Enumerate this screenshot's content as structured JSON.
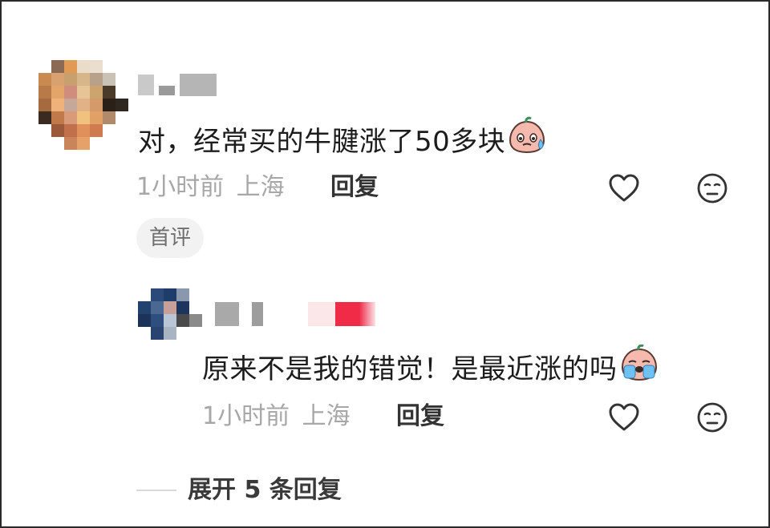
{
  "comments": [
    {
      "text": "对，经常买的牛腱涨了50多块",
      "emoji": "sweat-smile-emoji",
      "time": "1小时前",
      "location": "上海",
      "reply_label": "回复",
      "badge": "首评"
    },
    {
      "text": "原来不是我的错觉！是最近涨的吗",
      "emoji": "crying-emoji",
      "time": "1小时前",
      "location": "上海",
      "reply_label": "回复"
    }
  ],
  "expand_label": "展开 5 条回复",
  "icons": [
    "heart-icon",
    "neutral-face-icon"
  ],
  "colors": {
    "primary_text": "#1c1c1c",
    "meta_text": "#a7a7a7",
    "badge_bg": "#f2f2f2",
    "icon_stroke": "#333333"
  }
}
